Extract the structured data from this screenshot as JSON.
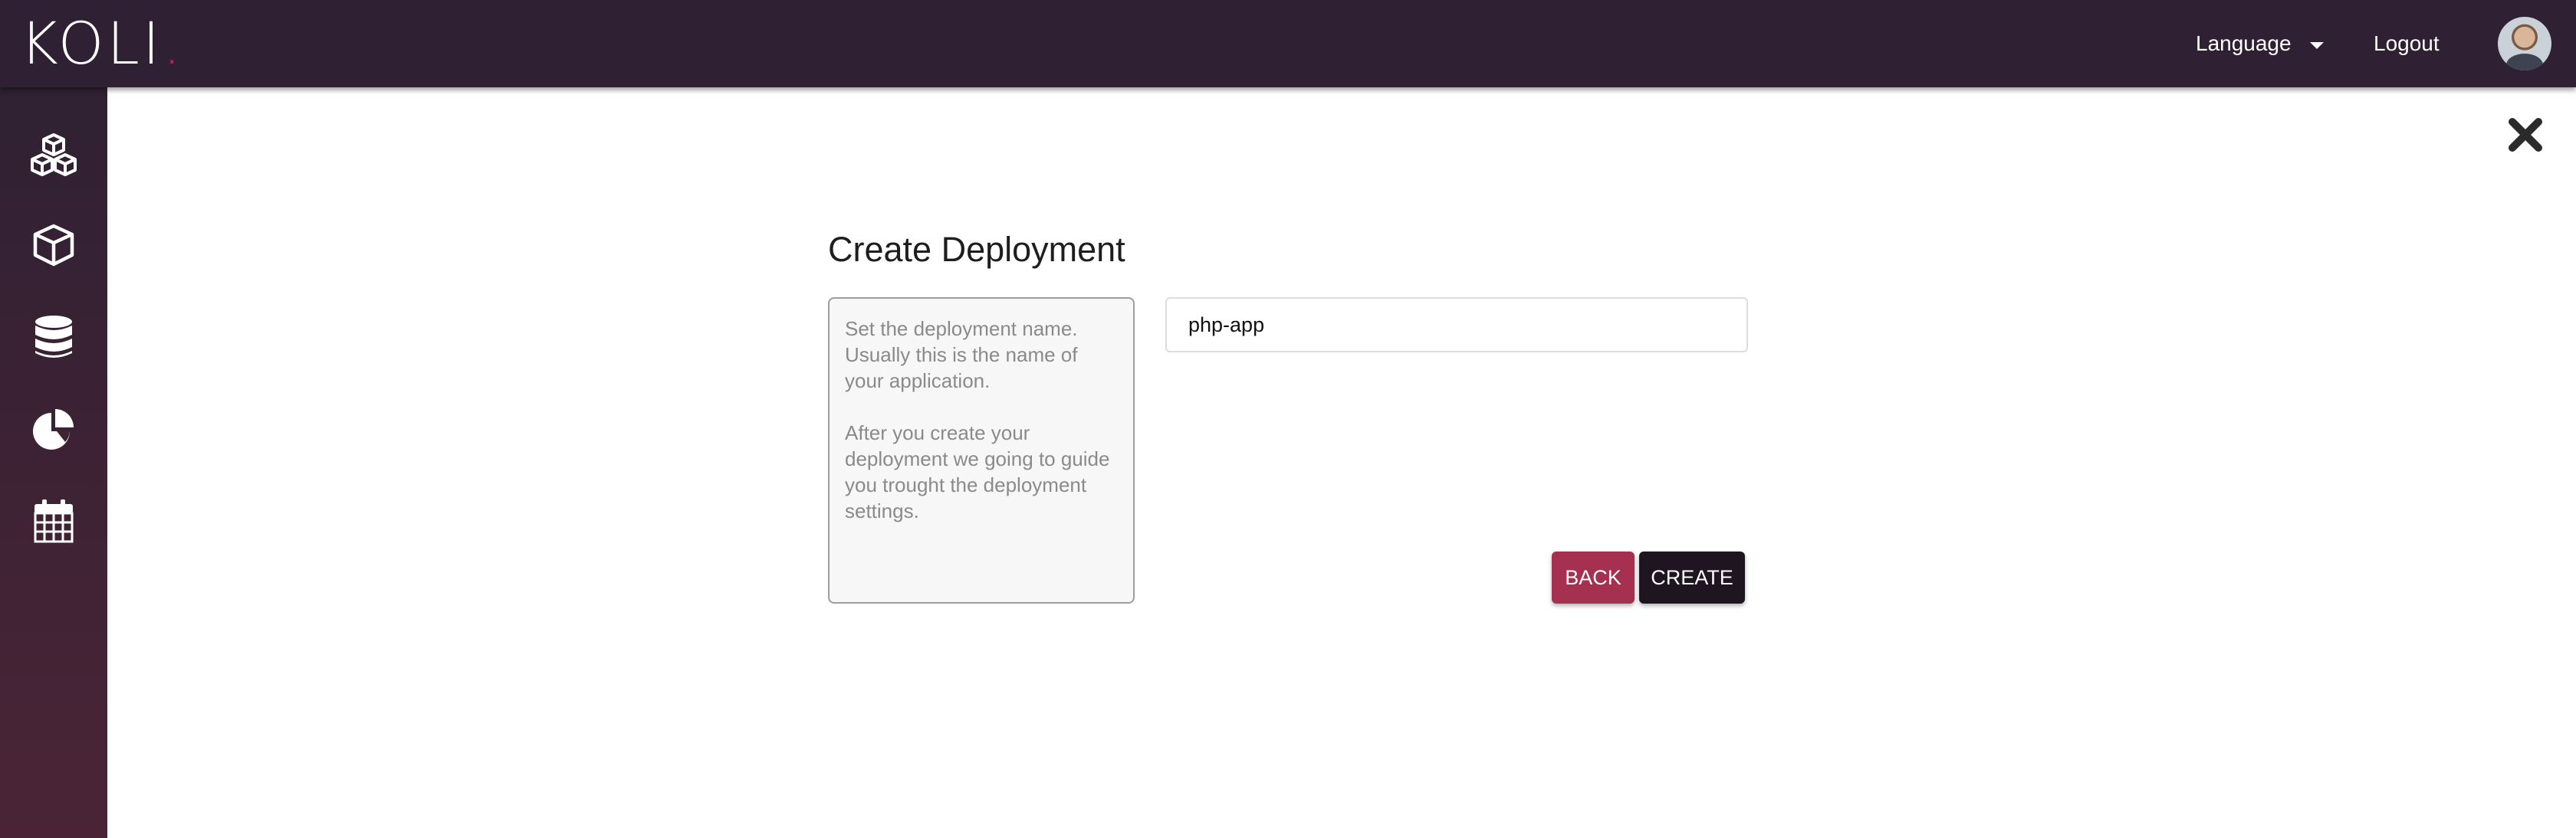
{
  "brand": {
    "logo_text": "KOLI",
    "logo_dot": "."
  },
  "header": {
    "language_label": "Language",
    "logout_label": "Logout"
  },
  "sidebar": {
    "items": [
      {
        "icon": "cubes-icon"
      },
      {
        "icon": "cube-icon"
      },
      {
        "icon": "database-icon"
      },
      {
        "icon": "pie-chart-icon"
      },
      {
        "icon": "calendar-icon"
      }
    ]
  },
  "form": {
    "title": "Create Deployment",
    "help_text_1": "Set the deployment name. Usually this is the name of your application.",
    "help_text_2": "After you create your deployment we going to guide you trought the deployment settings.",
    "name_value": "php-app",
    "back_label": "BACK",
    "create_label": "CREATE"
  },
  "colors": {
    "topbar": "#2f2133",
    "back_button": "#a6304f",
    "create_button": "#1f1521",
    "accent": "#c2185b"
  }
}
